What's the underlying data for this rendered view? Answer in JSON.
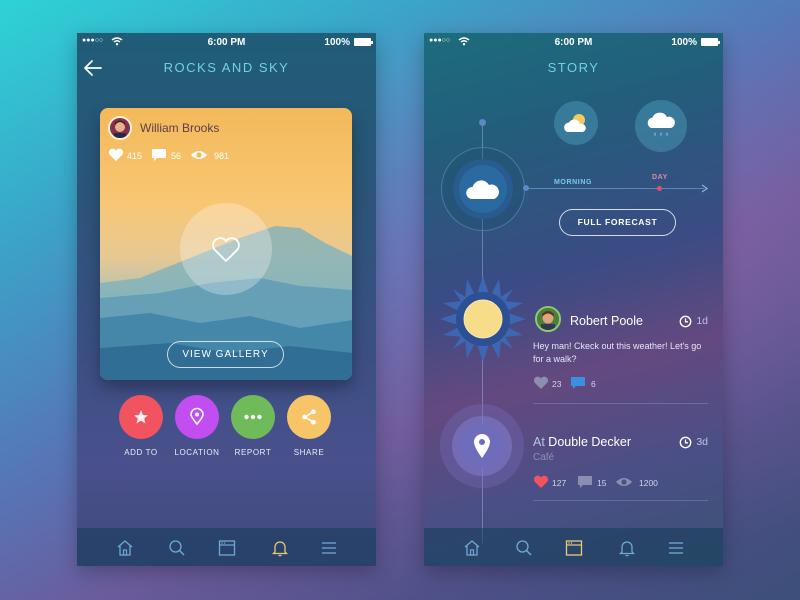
{
  "left_screen": {
    "status": {
      "time": "6:00 PM",
      "battery": "100%"
    },
    "title": "ROCKS AND SKY",
    "card": {
      "author": "William Brooks",
      "likes": "415",
      "comments": "56",
      "views": "981",
      "button": "VIEW GALLERY"
    },
    "actions": [
      {
        "label": "ADD TO",
        "color": "#f2545f",
        "icon": "star-icon"
      },
      {
        "label": "LOCATION",
        "color": "#c24df0",
        "icon": "location-pin-icon"
      },
      {
        "label": "REPORT",
        "color": "#6fbb5a",
        "icon": "more-dots-icon"
      },
      {
        "label": "SHARE",
        "color": "#f7c468",
        "icon": "share-icon"
      }
    ],
    "tabs": [
      "home-icon",
      "search-icon",
      "browser-icon",
      "bell-icon",
      "menu-icon"
    ],
    "active_tab": "bell-icon"
  },
  "right_screen": {
    "status": {
      "time": "6:00 PM",
      "battery": "100%"
    },
    "title": "STORY",
    "forecast": {
      "morning": "MORNING",
      "day": "DAY",
      "button": "FULL FORECAST"
    },
    "post1": {
      "name": "Robert Poole",
      "time": "1d",
      "text": "Hey man! Ckeck out this weather! Let's go for a walk?",
      "likes": "23",
      "comments": "6"
    },
    "post2": {
      "prefix": "At",
      "place": "Double Decker",
      "subtitle": "Café",
      "time": "3d",
      "likes": "127",
      "comments": "15",
      "views": "1200"
    },
    "tabs": [
      "home-icon",
      "search-icon",
      "browser-icon",
      "bell-icon",
      "menu-icon"
    ],
    "active_tab": "browser-icon"
  },
  "colors": {
    "accent_teal": "#6fd3dc",
    "like_red": "#f2545f",
    "comment_blue": "#3a8fe0",
    "sun_yellow": "#f7dc8a",
    "day_dot": "#e0506a"
  }
}
